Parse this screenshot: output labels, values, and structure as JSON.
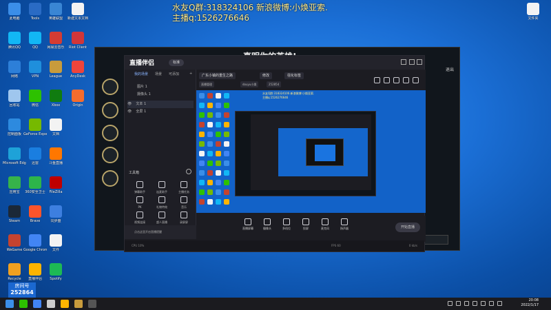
{
  "overlay": {
    "line1": "水友Q群:318324106 新浪微博:小焕亚索.",
    "line2": "主播q:1526276646"
  },
  "desktop": {
    "icons": [
      {
        "label": "此电脑",
        "color": "#3b8ee8"
      },
      {
        "label": "腾讯QQ",
        "color": "#12b7f5"
      },
      {
        "label": "网络",
        "color": "#2d7fd8"
      },
      {
        "label": "回收站",
        "color": "#9fc6ee"
      },
      {
        "label": "控制面板",
        "color": "#2d8adf"
      },
      {
        "label": "Microsoft Edge",
        "color": "#1ea2d8"
      },
      {
        "label": "应用宝",
        "color": "#36b34a"
      },
      {
        "label": "Steam",
        "color": "#1b2838"
      },
      {
        "label": "WeGame",
        "color": "#c4432f"
      },
      {
        "label": "Recycle",
        "color": "#f0a020"
      }
    ],
    "col2": [
      {
        "label": "Tools",
        "color": "#2a6bc4"
      },
      {
        "label": "QQ",
        "color": "#12b7f5"
      },
      {
        "label": "VPN",
        "color": "#1f8fdc"
      },
      {
        "label": "微信",
        "color": "#2dc100"
      },
      {
        "label": "GeForce Experience",
        "color": "#76b900"
      },
      {
        "label": "迅雷",
        "color": "#1a7ee0"
      },
      {
        "label": "360安全卫士",
        "color": "#2db54a"
      },
      {
        "label": "Brave",
        "color": "#fb542b"
      },
      {
        "label": "Google Chrome",
        "color": "#4285f4"
      },
      {
        "label": "直播伴侣",
        "color": "#ffb400"
      }
    ],
    "col3": [
      {
        "label": "英雄联盟",
        "color": "#3a86d4"
      },
      {
        "label": "网易云音乐",
        "color": "#d43c33"
      },
      {
        "label": "League",
        "color": "#c89b3c"
      },
      {
        "label": "Xbox",
        "color": "#107c10"
      },
      {
        "label": "文档",
        "color": "#f3f3f3"
      },
      {
        "label": "斗鱼直播",
        "color": "#ff7700"
      },
      {
        "label": "FileZilla",
        "color": "#bf0000"
      },
      {
        "label": "同步盘",
        "color": "#3d7fe0"
      },
      {
        "label": "文件",
        "color": "#f3f3f3"
      },
      {
        "label": "Spotify",
        "color": "#1db954"
      }
    ],
    "col4": [
      {
        "label": "新建文本文档",
        "color": "#f3f3f3"
      },
      {
        "label": "Riot Client",
        "color": "#d13639"
      },
      {
        "label": "AnyDesk",
        "color": "#ef443b"
      },
      {
        "label": "Origin",
        "color": "#f56c2d"
      }
    ],
    "right_icon": {
      "label": "文件夹",
      "color": "#f3f3f3"
    }
  },
  "game": {
    "title": "真明你的英雄!",
    "corner_label": "退出"
  },
  "app": {
    "logo": "直播伴侣",
    "badge": "标准",
    "left_tabs": [
      "我的场景",
      "场景",
      "可添加"
    ],
    "layers": [
      {
        "name": "图片 1"
      },
      {
        "name": "摄像头 1"
      },
      {
        "name": "文本 1"
      },
      {
        "name": "全屏 1"
      }
    ],
    "tools_title": "工具箱",
    "tools": [
      {
        "label": "弹幕助手"
      },
      {
        "label": "连麦助手"
      },
      {
        "label": "主播任务"
      },
      {
        "label": "PK"
      },
      {
        "label": "礼物特效"
      },
      {
        "label": "音乐"
      },
      {
        "label": "视频连接"
      },
      {
        "label": "超人直播"
      },
      {
        "label": "录屏屏"
      },
      {
        "label": "虚拟形象"
      },
      {
        "label": "弹幕机"
      },
      {
        "label": "数据面板"
      }
    ],
    "hint": "点击这里开启直播提醒",
    "categories": [
      {
        "label": "广东小镇的重生之路"
      },
      {
        "label": "修改"
      },
      {
        "label": "强化标签"
      }
    ],
    "info": [
      {
        "label": "直播管理"
      },
      {
        "label": "douyu小焕"
      },
      {
        "label": "252854"
      }
    ],
    "preview": {
      "line1": "水友Q群:318324106 新浪微博:小焕亚索.",
      "line2": "主播q:1526276646"
    },
    "bottom_buttons": [
      {
        "label": "直播屏幕"
      },
      {
        "label": "摄像头"
      },
      {
        "label": "多机位"
      },
      {
        "label": "投屏"
      },
      {
        "label": "麦克风"
      },
      {
        "label": "扬声器"
      }
    ],
    "live_button": "开始直播",
    "status": {
      "left": "CPU 10%",
      "mid": "FPS 60",
      "right": "0 kb/s"
    }
  },
  "room": {
    "label": "房间号",
    "id": "252864"
  },
  "taskbar": {
    "time": "20:08",
    "date": "2022/1/17"
  }
}
